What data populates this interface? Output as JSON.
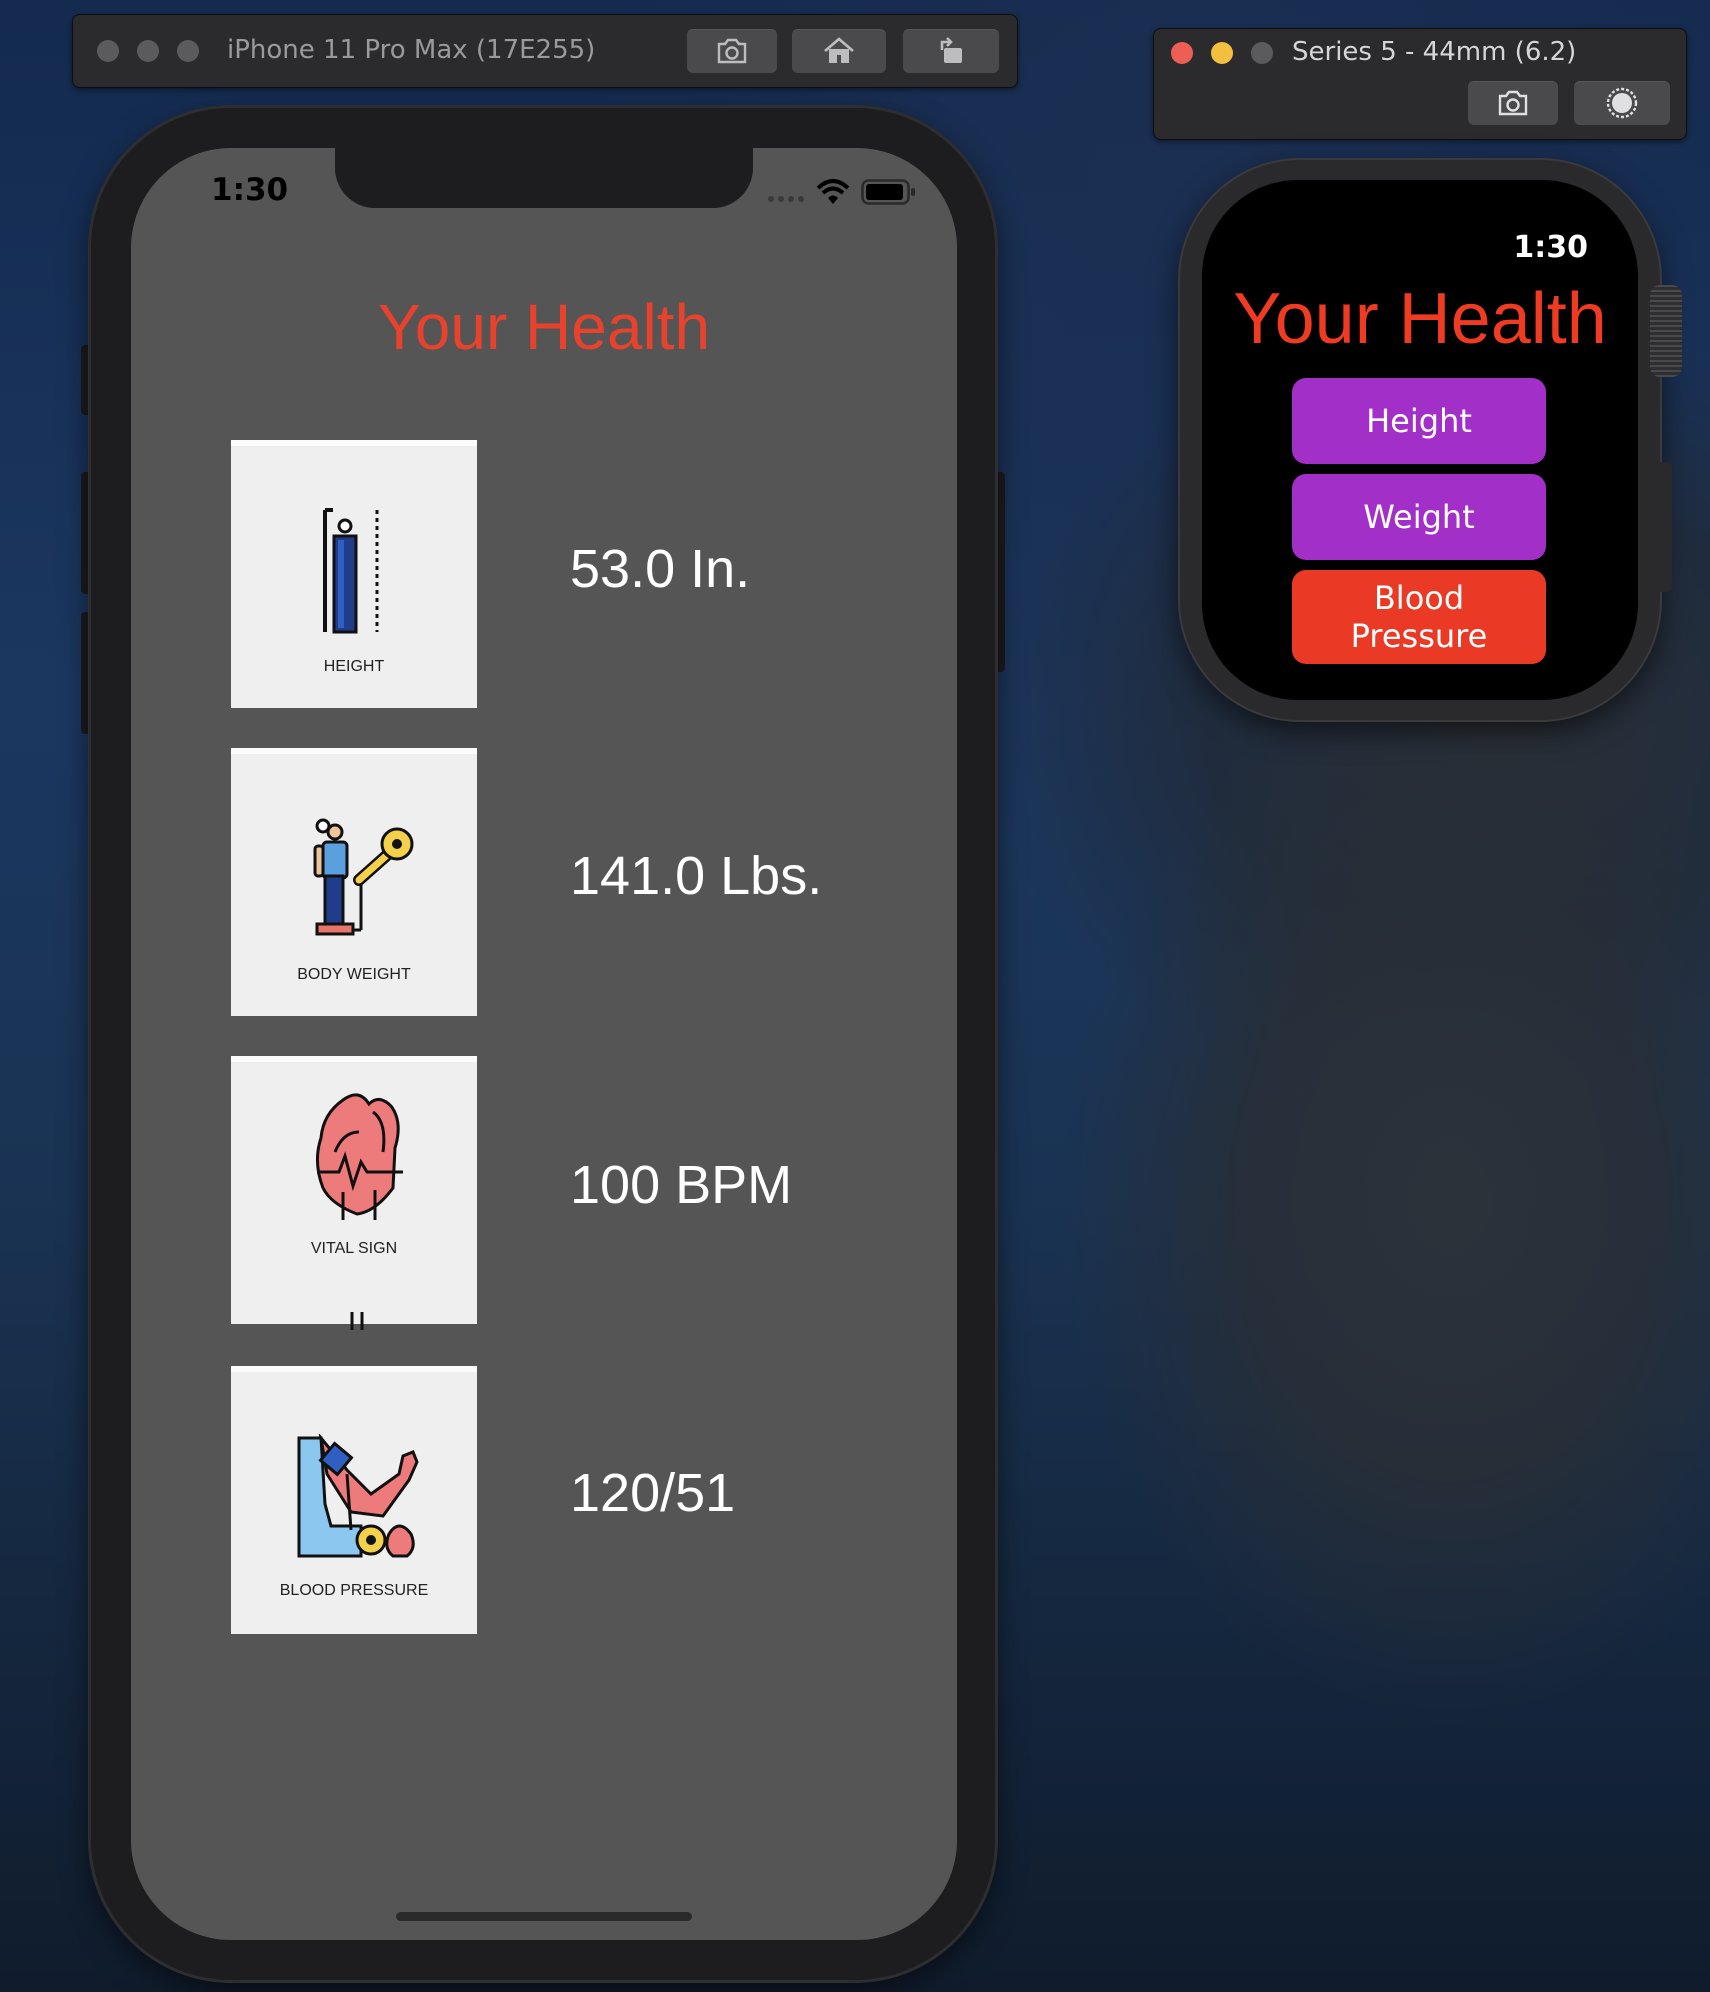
{
  "iphone_window": {
    "title": "iPhone 11 Pro Max (17E255)",
    "buttons": [
      "screenshot-icon",
      "home-icon",
      "rotate-icon"
    ]
  },
  "watch_window": {
    "title": "Series 5 - 44mm (6.2)",
    "buttons": [
      "screenshot-icon",
      "record-icon"
    ]
  },
  "phone": {
    "status_time": "1:30",
    "title": "Your Health",
    "rows": [
      {
        "caption": "HEIGHT",
        "value": "53.0 In."
      },
      {
        "caption": "BODY WEIGHT",
        "value": "141.0 Lbs."
      },
      {
        "caption": "VITAL SIGN",
        "value": "100 BPM"
      },
      {
        "caption": "BLOOD PRESSURE",
        "value": "120/51"
      }
    ]
  },
  "watch": {
    "time": "1:30",
    "title": "Your Health",
    "buttons": [
      {
        "label": "Height",
        "color": "#a32fc9"
      },
      {
        "label": "Weight",
        "color": "#a32fc9"
      },
      {
        "label": "Blood Pressure",
        "color": "#ea3a25"
      }
    ]
  },
  "colors": {
    "accent_red": "#e8422c",
    "watch_purple": "#a32fc9",
    "phone_bg": "#555555"
  }
}
